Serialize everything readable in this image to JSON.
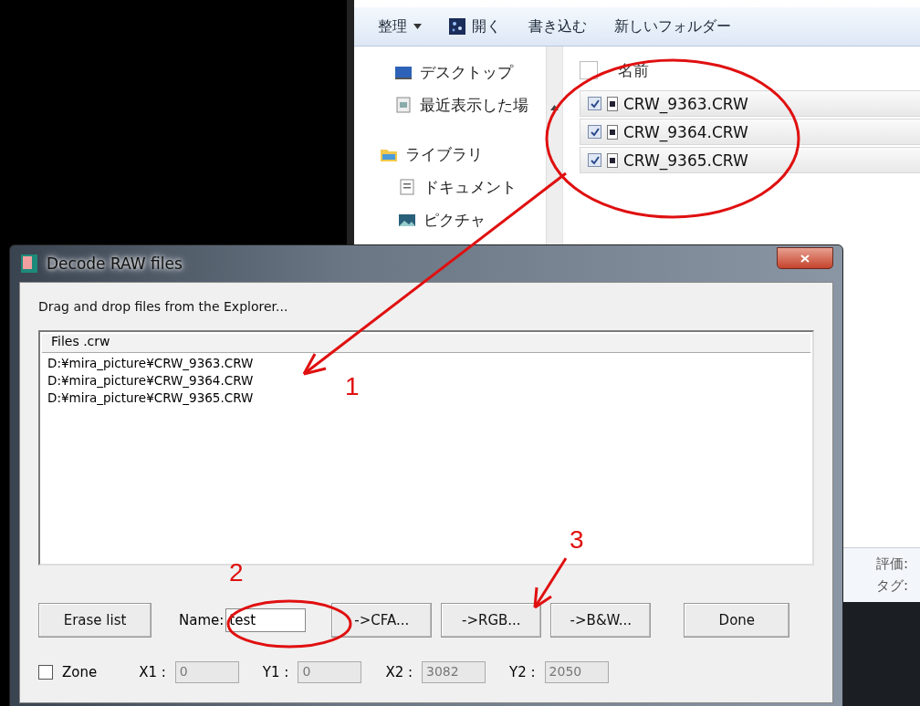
{
  "explorer": {
    "toolbar": [
      {
        "label": "整理",
        "kind": "menu"
      },
      {
        "label": "開く",
        "kind": "icon"
      },
      {
        "label": "書き込む",
        "kind": "plain"
      },
      {
        "label": "新しいフォルダー",
        "kind": "plain"
      }
    ],
    "nav": [
      {
        "label": "デスクトップ",
        "kind": "desktop"
      },
      {
        "label": "最近表示した場",
        "kind": "recent"
      },
      {
        "label": "ライブラリ",
        "kind": "library",
        "children": [
          {
            "label": "ドキュメント",
            "kind": "document"
          },
          {
            "label": "ピクチャ",
            "kind": "picture"
          }
        ]
      }
    ],
    "column": "名前",
    "select_all": false,
    "files": [
      {
        "name": "CRW_9363.CRW",
        "checked": true
      },
      {
        "name": "CRW_9364.CRW",
        "checked": true
      },
      {
        "name": "CRW_9365.CRW",
        "checked": true
      }
    ],
    "details": [
      "評価:",
      "タグ:"
    ]
  },
  "dialog": {
    "title": "Decode RAW files",
    "instruction": "Drag and drop files from the Explorer...",
    "list_header": "Files .crw",
    "rows": [
      "D:¥mira_picture¥CRW_9363.CRW",
      "D:¥mira_picture¥CRW_9364.CRW",
      "D:¥mira_picture¥CRW_9365.CRW"
    ],
    "erase": "Erase list",
    "name_label": "Name:",
    "name_value": "test",
    "actions": [
      "->CFA...",
      "->RGB...",
      "->B&W..."
    ],
    "done": "Done",
    "zone": {
      "label": "Zone",
      "checked": false
    },
    "coords": [
      {
        "label": "X1 :",
        "value": "0",
        "disabled": true
      },
      {
        "label": "Y1 :",
        "value": "0",
        "disabled": true
      },
      {
        "label": "X2 :",
        "value": "3082",
        "disabled": true
      },
      {
        "label": "Y2 :",
        "value": "2050",
        "disabled": true
      }
    ]
  },
  "annotations": [
    "1",
    "2",
    "3"
  ]
}
